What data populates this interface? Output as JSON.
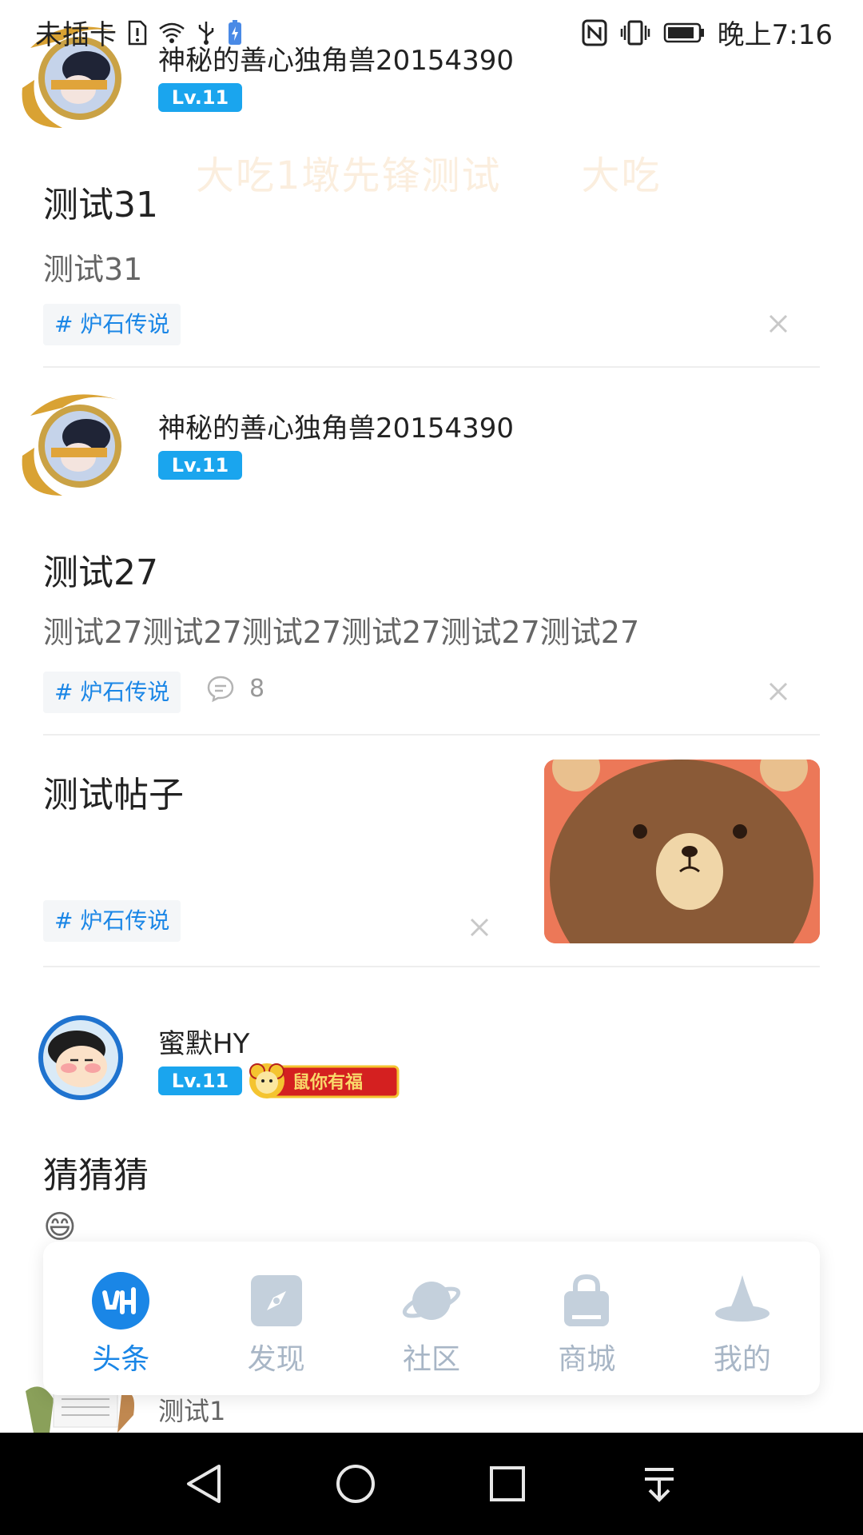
{
  "status_bar": {
    "carrier": "未插卡",
    "time": "晚上7:16"
  },
  "banner_text": "大吃1墩先锋测试　　大吃",
  "posts": [
    {
      "author": "神秘的善心独角兽20154390",
      "level": "Lv.11",
      "title": "测试31",
      "body": "测试31",
      "tag": "# 炉石传说"
    },
    {
      "author": "神秘的善心独角兽20154390",
      "level": "Lv.11",
      "title": "测试27",
      "body": "测试27测试27测试27测试27测试27测试27",
      "tag": "# 炉石传说",
      "comment_count": "8"
    },
    {
      "title": "测试帖子",
      "tag": "# 炉石传说"
    },
    {
      "author": "蜜默HY",
      "level": "Lv.11",
      "badge": "鼠你有福",
      "title": "猜猜猜",
      "emoji": "😄"
    },
    {
      "author": "测试1"
    }
  ],
  "bottom_nav": {
    "items": [
      {
        "label": "头条",
        "icon": "headlines-logo-icon",
        "active": true
      },
      {
        "label": "发现",
        "icon": "compass-icon",
        "active": false
      },
      {
        "label": "社区",
        "icon": "planet-icon",
        "active": false
      },
      {
        "label": "商城",
        "icon": "shopping-bag-icon",
        "active": false
      },
      {
        "label": "我的",
        "icon": "wizard-hat-icon",
        "active": false
      }
    ]
  },
  "colors": {
    "accent": "#1a86e6",
    "level_badge": "#1aa5ee",
    "inactive_nav": "#a8b6c6"
  }
}
